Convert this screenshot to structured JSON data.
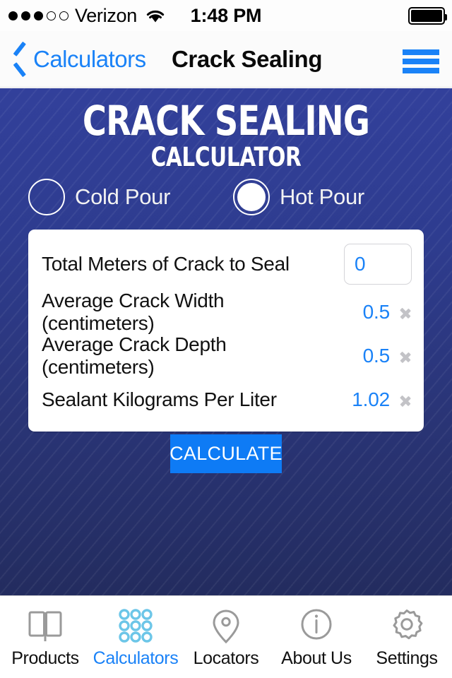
{
  "status_bar": {
    "carrier": "Verizon",
    "signal_filled": 3,
    "signal_empty": 2,
    "wifi_icon": "wifi-icon",
    "time": "1:48 PM",
    "battery_icon": "battery-full-icon"
  },
  "nav_bar": {
    "back_label": "Calculators",
    "back_icon": "chevron-left-icon",
    "title": "Crack Sealing",
    "menu_icon": "hamburger-menu-icon"
  },
  "hero": {
    "title": "CRACK SEALING",
    "subtitle": "CALCULATOR"
  },
  "options": {
    "items": [
      {
        "label": "Cold Pour",
        "selected": false
      },
      {
        "label": "Hot Pour",
        "selected": true
      }
    ]
  },
  "form": {
    "rows": [
      {
        "label": "Total Meters of Crack to Seal",
        "type": "input",
        "value": "0",
        "placeholder": "0"
      },
      {
        "label": "Average Crack Width (centimeters)",
        "type": "select",
        "value": "0.5",
        "chevron": "chevron-right-icon"
      },
      {
        "label": "Average Crack Depth (centimeters)",
        "type": "select",
        "value": "0.5",
        "chevron": "chevron-right-icon"
      },
      {
        "label": "Sealant Kilograms Per Liter",
        "type": "select",
        "value": "1.02",
        "chevron": "chevron-right-icon"
      }
    ]
  },
  "calculate_button": {
    "label": "CALCULATE"
  },
  "tab_bar": {
    "items": [
      {
        "label": "Products",
        "icon": "book-icon",
        "active": false
      },
      {
        "label": "Calculators",
        "icon": "grid-dots-icon",
        "active": true
      },
      {
        "label": "Locators",
        "icon": "map-pin-icon",
        "active": false
      },
      {
        "label": "About Us",
        "icon": "info-circle-icon",
        "active": false
      },
      {
        "label": "Settings",
        "icon": "gear-icon",
        "active": false
      }
    ]
  },
  "colors": {
    "accent_blue": "#1a82f7",
    "button_blue": "#0e7bf5",
    "panel_top": "#32409b",
    "panel_bottom": "#232c5f",
    "active_tab_icon": "#6cc6e8",
    "inactive_icon": "#9a9a9a"
  }
}
